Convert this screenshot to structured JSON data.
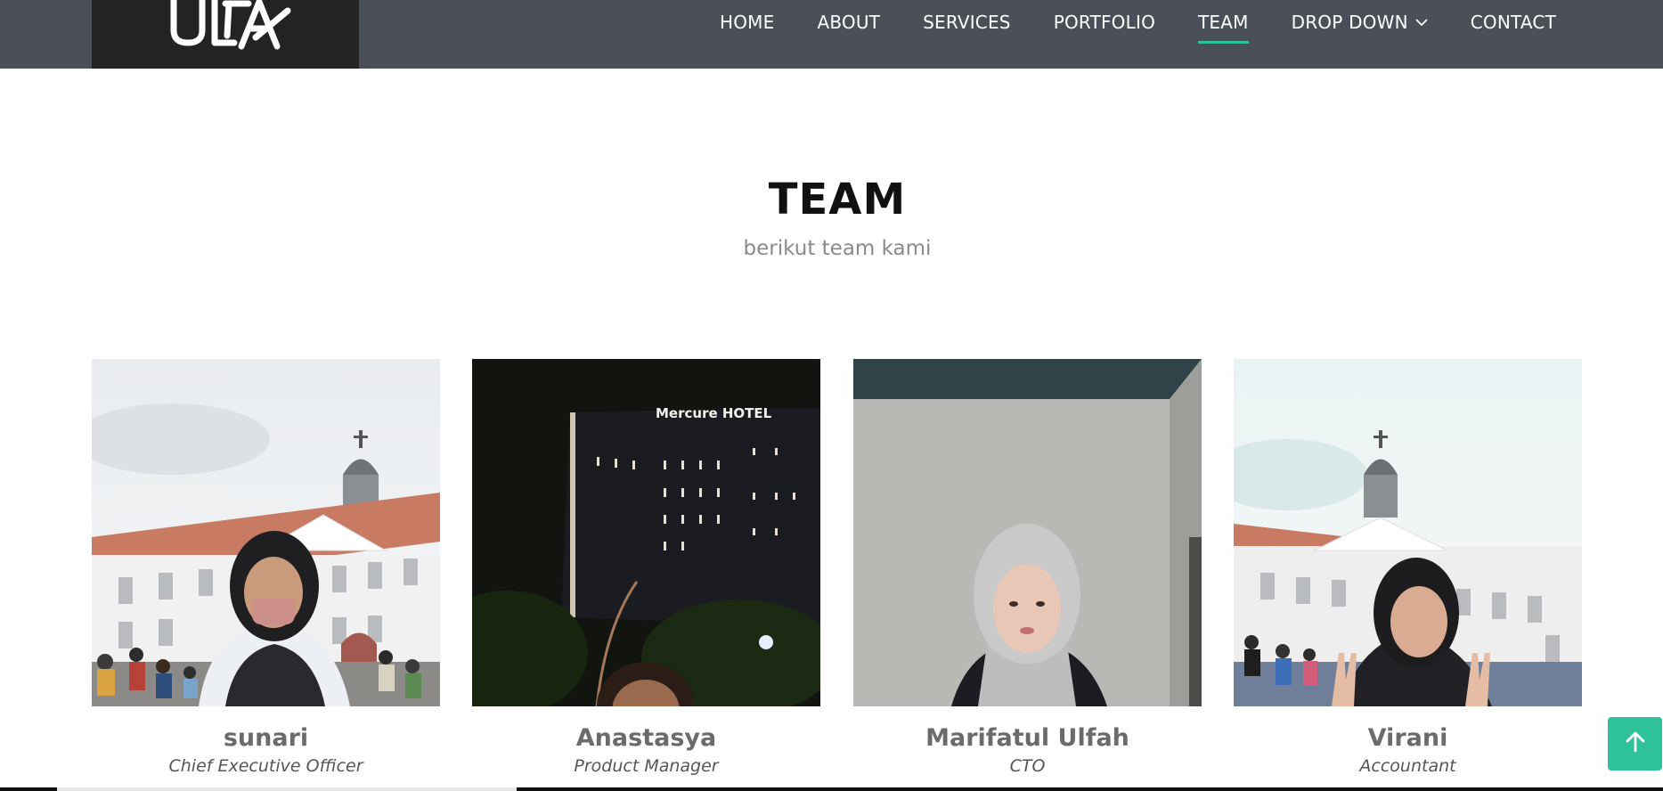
{
  "header": {
    "logo_alt": "ULFA logo",
    "nav": [
      {
        "label": "HOME",
        "active": false
      },
      {
        "label": "ABOUT",
        "active": false
      },
      {
        "label": "SERVICES",
        "active": false
      },
      {
        "label": "PORTFOLIO",
        "active": false
      },
      {
        "label": "TEAM",
        "active": true
      },
      {
        "label": "DROP DOWN",
        "active": false,
        "icon": "chevron-down-icon"
      },
      {
        "label": "CONTACT",
        "active": false
      }
    ]
  },
  "section": {
    "title": "TEAM",
    "subtitle": "berikut team kami"
  },
  "team": [
    {
      "name": "sunari",
      "role": "Chief Executive Officer"
    },
    {
      "name": "Anastasya",
      "role": "Product Manager"
    },
    {
      "name": "Marifatul Ulfah",
      "role": "CTO"
    },
    {
      "name": "Virani",
      "role": "Accountant"
    }
  ],
  "photo_texts": {
    "hotel_sign": "Mercure HOTEL"
  },
  "back_to_top": {
    "icon": "arrow-up-icon"
  },
  "colors": {
    "header_bg": "#4a4f58",
    "accent": "#2fc19a",
    "logo_bg": "#232323"
  }
}
